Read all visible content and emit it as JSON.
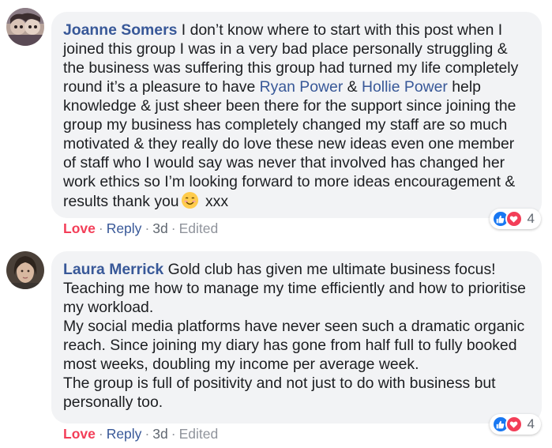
{
  "comments": [
    {
      "author": "Joanne Somers",
      "avatar_icon": "avatar-photo",
      "text_parts": [
        " I don’t know where to start with this post when I joined this group I was in a very bad place personally struggling & the business was suffering this group had turned my life completely round it’s a pleasure to have ",
        " & ",
        " help knowledge & just sheer been there for the support since joining the group my business has completely changed my staff are so much motivated & they really do love these new ideas even one member of staff who I would say was never that involved has changed her work ethics so I’m looking forward to more ideas encouragement & results thank you",
        " xxx"
      ],
      "mentions": [
        "Ryan Power",
        "Hollie Power"
      ],
      "emoji": "smiling-face-emoji",
      "reaction_count": "4",
      "reaction_icons": [
        "like-icon",
        "love-icon"
      ],
      "actions": {
        "love": "Love",
        "reply": "Reply",
        "time": "3d",
        "edited": "Edited",
        "separator": "·"
      }
    },
    {
      "author": "Laura Merrick",
      "avatar_icon": "avatar-photo",
      "text_lines": [
        " Gold club has given me ultimate business focus!",
        "Teaching me how to manage my time efficiently and how to prioritise my workload.",
        "My social media platforms have never seen such a dramatic organic reach. Since joining my diary has gone from half full to fully booked most weeks, doubling my income per average week.",
        "The group is full of positivity and not just to do with business but personally too."
      ],
      "reaction_count": "4",
      "reaction_icons": [
        "like-icon",
        "love-icon"
      ],
      "actions": {
        "love": "Love",
        "reply": "Reply",
        "time": "3d",
        "edited": "Edited",
        "separator": "·"
      }
    }
  ],
  "colors": {
    "link": "#385898",
    "love": "#f33e58",
    "like": "#1877f2",
    "bubble": "#f2f3f5",
    "meta": "#90949c"
  }
}
